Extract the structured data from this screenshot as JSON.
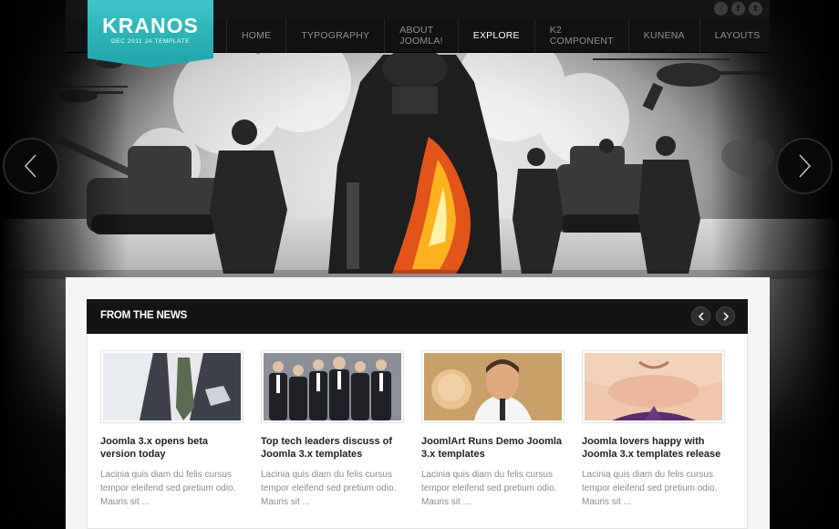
{
  "brand": {
    "name": "KRANOS",
    "tagline": "DEC 2011 JA TEMPLATE",
    "accent_color": "#2bb5b8"
  },
  "social": [
    {
      "icon": "rss-icon",
      "glyph": "◦"
    },
    {
      "icon": "facebook-icon",
      "glyph": "f"
    },
    {
      "icon": "twitter-icon",
      "glyph": "t"
    }
  ],
  "nav": {
    "items": [
      {
        "label": "HOME"
      },
      {
        "label": "TYPOGRAPHY"
      },
      {
        "label": "ABOUT JOOMLA!"
      },
      {
        "label": "EXPLORE",
        "active": true
      },
      {
        "label": "K2 COMPONENT"
      },
      {
        "label": "KUNENA"
      },
      {
        "label": "LAYOUTS"
      }
    ]
  },
  "slider": {
    "prev_icon": "chevron-left-icon",
    "next_icon": "chevron-right-icon"
  },
  "news": {
    "title": "FROM THE NEWS",
    "items": [
      {
        "title": "Joomla 3.x opens beta version today",
        "text": "Lacinia quis diam du felis cursus tempor eleifend sed pretium odio. Mauris sit ..."
      },
      {
        "title": "Top tech leaders discuss of Joomla 3.x templates",
        "text": "Lacinia quis diam du felis cursus tempor eleifend sed pretium odio. Mauris sit ..."
      },
      {
        "title": "JoomlArt Runs Demo Joomla 3.x templates",
        "text": "Lacinia quis diam du felis cursus tempor eleifend sed pretium odio. Mauris sit ..."
      },
      {
        "title": "Joomla lovers happy with Joomla 3.x templates release",
        "text": "Lacinia quis diam du felis cursus tempor eleifend sed pretium odio. Mauris sit ..."
      }
    ]
  }
}
